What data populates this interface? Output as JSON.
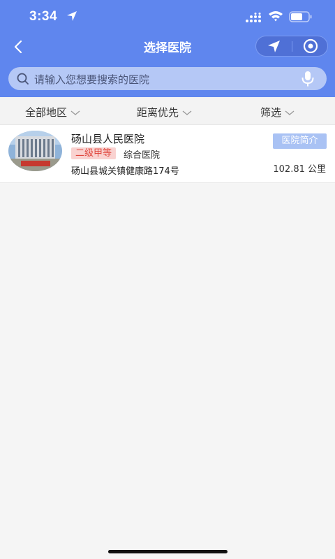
{
  "status_bar": {
    "time": "3:34"
  },
  "nav": {
    "title": "选择医院"
  },
  "search": {
    "placeholder": "请输入您想要搜索的医院"
  },
  "filters": [
    {
      "label": "全部地区"
    },
    {
      "label": "距离优先"
    },
    {
      "label": "筛选"
    }
  ],
  "hospitals": [
    {
      "name": "砀山县人民医院",
      "grade": "二级甲等",
      "type": "综合医院",
      "address": "砀山县城关镇健康路174号",
      "intro_label": "医院简介",
      "distance": "102.81 公里"
    }
  ],
  "colors": {
    "header_bg": "#5f86ee",
    "grade_tag_bg": "#f9d2d0",
    "grade_tag_text": "#e0463d",
    "intro_btn_bg": "#a9c2f4"
  },
  "icons": [
    "location-arrow-icon",
    "signal-icon",
    "wifi-icon",
    "battery-icon",
    "back-icon",
    "navigate-icon",
    "eye-icon",
    "search-icon",
    "microphone-icon",
    "chevron-down-icon"
  ]
}
